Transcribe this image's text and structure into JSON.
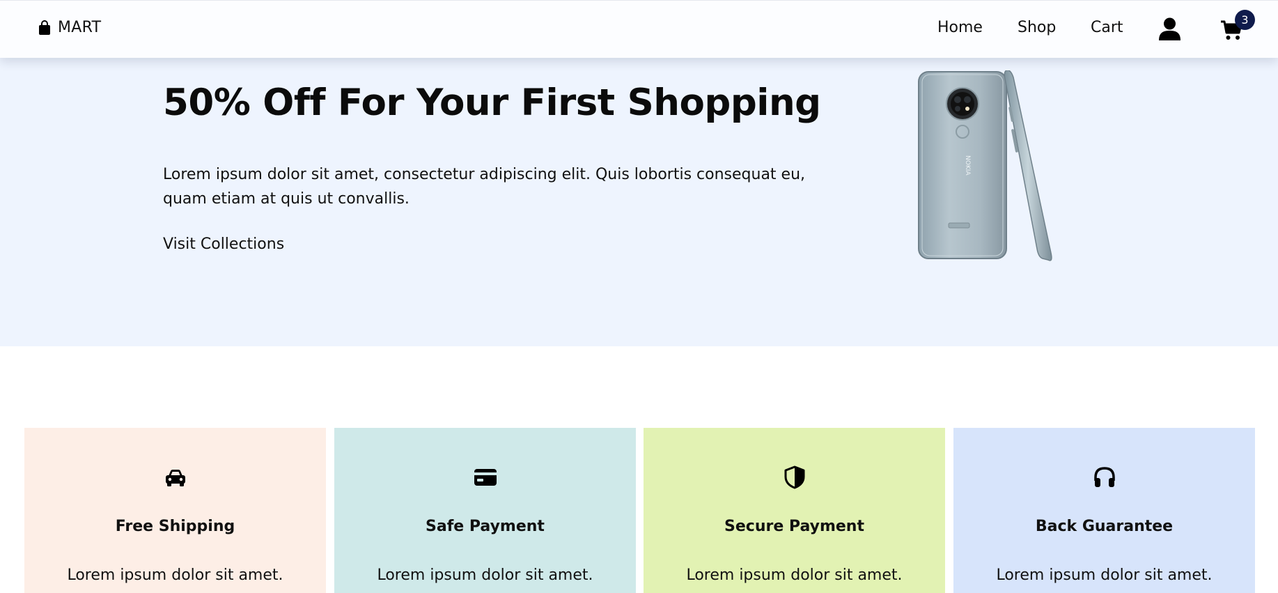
{
  "navbar": {
    "brand": "MART",
    "links": [
      "Home",
      "Shop",
      "Cart"
    ],
    "cart_count": "3",
    "icons": [
      "shopping-bag-icon",
      "user-icon",
      "cart-icon"
    ]
  },
  "hero": {
    "title": "50% Off For Your First Shopping",
    "description": "Lorem ipsum dolor sit amet, consectetur adipiscing elit. Quis lobortis consequat eu, quam etiam at quis ut convallis.",
    "cta": "Visit Collections",
    "background": "#eef4fe",
    "image": "smartphone-product-image"
  },
  "features": [
    {
      "icon": "car-icon",
      "title": "Free Shipping",
      "text": "Lorem ipsum dolor sit amet.",
      "color": "#fdeee6"
    },
    {
      "icon": "credit-card-icon",
      "title": "Safe Payment",
      "text": "Lorem ipsum dolor sit amet.",
      "color": "#cfe9e9"
    },
    {
      "icon": "shield-icon",
      "title": "Secure Payment",
      "text": "Lorem ipsum dolor sit amet.",
      "color": "#e2f2b3"
    },
    {
      "icon": "headphones-icon",
      "title": "Back Guarantee",
      "text": "Lorem ipsum dolor sit amet.",
      "color": "#d7e4fb"
    }
  ]
}
